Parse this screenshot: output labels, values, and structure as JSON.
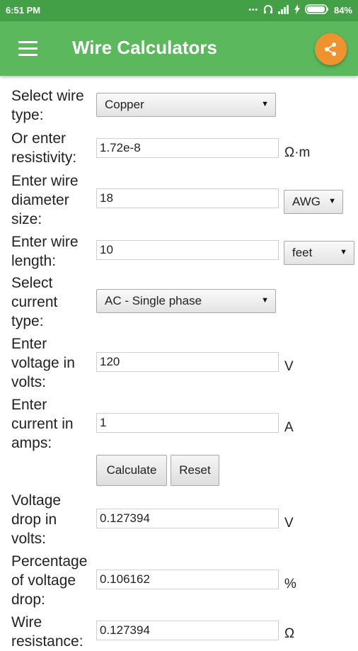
{
  "status_bar": {
    "time": "6:51 PM",
    "battery": "84%",
    "icons": [
      "more-dots-icon",
      "headphones-icon",
      "signal-icon",
      "charging-icon",
      "battery-icon"
    ]
  },
  "app_bar": {
    "title": "Wire Calculators",
    "menu_icon": "menu-icon",
    "share_icon": "share-icon",
    "colors": {
      "primary": "#5cb85c",
      "status": "#43a047",
      "accent": "#f0922d"
    }
  },
  "form": {
    "wire_type": {
      "label": "Select wire type:",
      "selected": "Copper"
    },
    "resistivity": {
      "label": "Or enter resistivity:",
      "value": "1.72e-8",
      "unit": "Ω·m"
    },
    "diameter": {
      "label": "Enter wire diameter size:",
      "value": "18",
      "unit_selected": "AWG"
    },
    "length": {
      "label": "Enter wire length:",
      "value": "10",
      "unit_selected": "feet"
    },
    "current_type": {
      "label": "Select current type:",
      "selected": "AC - Single phase"
    },
    "voltage": {
      "label": "Enter voltage in volts:",
      "value": "120",
      "unit": "V"
    },
    "current": {
      "label": "Enter current in amps:",
      "value": "1",
      "unit": "A"
    },
    "calculate_label": "Calculate",
    "reset_label": "Reset"
  },
  "results": {
    "voltage_drop": {
      "label": "Voltage drop in volts:",
      "value": "0.127394",
      "unit": "V"
    },
    "percent_drop": {
      "label": "Percentage of voltage drop:",
      "value": "0.106162",
      "unit": "%"
    },
    "resistance": {
      "label": "Wire resistance:",
      "value": "0.127394",
      "unit": "Ω"
    }
  }
}
